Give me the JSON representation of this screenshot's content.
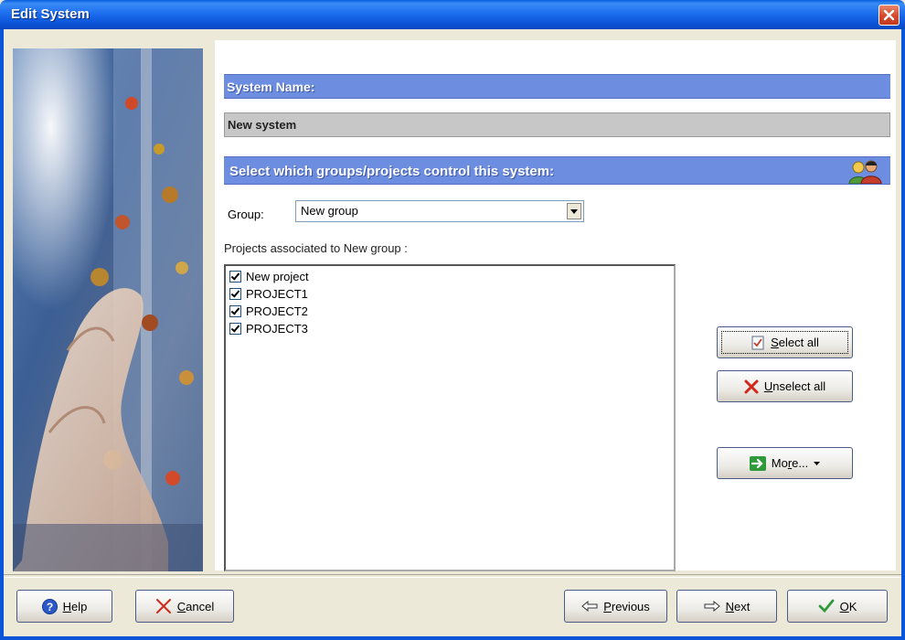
{
  "window": {
    "title": "Edit System",
    "close_icon": "close-icon"
  },
  "system_name": {
    "header": "System Name:",
    "value": "New system"
  },
  "groups": {
    "header": "Select which groups/projects control this system:",
    "icon": "users-icon",
    "group_label": "Group:",
    "group_value": "New group",
    "projects_label": "Projects associated to New group :",
    "projects": [
      {
        "label": "New project",
        "checked": true
      },
      {
        "label": "PROJECT1",
        "checked": true
      },
      {
        "label": "PROJECT2",
        "checked": true
      },
      {
        "label": "PROJECT3",
        "checked": true
      }
    ]
  },
  "actions": {
    "select_all_u": "S",
    "select_all_rest": "elect all",
    "unselect_all_u": "U",
    "unselect_all_rest": "nselect all",
    "more_pre": "Mo",
    "more_u": "r",
    "more_post": "e..."
  },
  "footer": {
    "help_u": "H",
    "help_rest": "elp",
    "cancel_u": "C",
    "cancel_rest": "ancel",
    "previous_u": "P",
    "previous_rest": "revious",
    "next_u": "N",
    "next_rest": "ext",
    "ok_u": "O",
    "ok_rest": "K"
  },
  "colors": {
    "header_bar": "#6d8ee0",
    "title_bar": "#0b54d8",
    "dialog_bg": "#ece9d8"
  }
}
